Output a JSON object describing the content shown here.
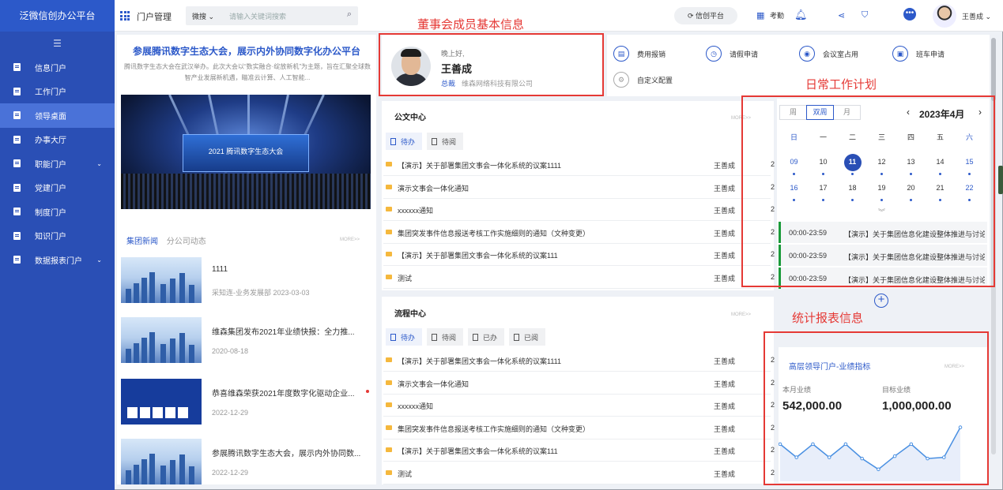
{
  "app": {
    "brand": "泛微信创办公平台"
  },
  "sidebar": {
    "items": [
      {
        "label": "信息门户",
        "caret": ""
      },
      {
        "label": "工作门户",
        "caret": ""
      },
      {
        "label": "领导桌面",
        "caret": ""
      },
      {
        "label": "办事大厅",
        "caret": ""
      },
      {
        "label": "职能门户",
        "caret": "⌄"
      },
      {
        "label": "党建门户",
        "caret": ""
      },
      {
        "label": "制度门户",
        "caret": ""
      },
      {
        "label": "知识门户",
        "caret": ""
      },
      {
        "label": "数据报表门户",
        "caret": "⌄"
      }
    ],
    "active_index": 2
  },
  "header": {
    "title": "门户管理",
    "search": {
      "scope": "微搜",
      "placeholder": "请输入关键词搜索"
    },
    "platform_label": "信创平台",
    "attendance_label": "考勤",
    "user_name": "王善成"
  },
  "news": {
    "headline": "参展腾讯数字生态大会，展示内外协同数字化办公平台",
    "summary": "腾讯数字生态大会在武汉举办。此次大会以“数实融合·绽放新机”为主题，旨在汇聚全球数智产业发展新机遇，瞄准云计算、人工智能...",
    "hero_caption": "2021 腾讯数字生态大会",
    "tabs": [
      "集团新闻",
      "分公司动态"
    ],
    "more": "MORE>>",
    "items": [
      {
        "title": "1111",
        "meta": "采知连-业务发展部 2023-03-03"
      },
      {
        "title": "维森集团发布2021年业绩快报：全力推...",
        "meta": "2020-08-18"
      },
      {
        "title": "恭喜维森荣获2021年度数字化驱动企业...",
        "meta": "2022-12-29"
      },
      {
        "title": "参展腾讯数字生态大会，展示内外协同数...",
        "meta": "2022-12-29"
      }
    ]
  },
  "profile": {
    "greeting": "晚上好,",
    "name": "王善成",
    "title": "总裁",
    "company": "维森网络科技有限公司"
  },
  "quick_actions": [
    {
      "label": "费用报销",
      "icon": "receipt-icon"
    },
    {
      "label": "请假申请",
      "icon": "clock-icon"
    },
    {
      "label": "会议室占用",
      "icon": "meeting-icon"
    },
    {
      "label": "班车申请",
      "icon": "bus-icon"
    },
    {
      "label": "自定义配置",
      "icon": "gear-icon"
    }
  ],
  "doc_center": {
    "title": "公文中心",
    "more": "MORE>>",
    "tabs": [
      "待办",
      "待阅"
    ],
    "rows": [
      {
        "title": "【演示】关于部署集团文事会一体化系统的议案1111",
        "user": "王善成",
        "tail": "2"
      },
      {
        "title": "演示文事会一体化通知",
        "user": "王善成",
        "tail": "2"
      },
      {
        "title": "xxxxxx通知",
        "user": "王善成",
        "tail": "2"
      },
      {
        "title": "集团突发事件信息报送考核工作实施细则的通知（文种变更）",
        "user": "王善成",
        "tail": "2"
      },
      {
        "title": "【演示】关于部署集团文事会一体化系统的议案111",
        "user": "王善成",
        "tail": "2"
      },
      {
        "title": "测试",
        "user": "王善成",
        "tail": "2"
      }
    ]
  },
  "flow_center": {
    "title": "流程中心",
    "more": "MORE>>",
    "tabs": [
      "待办",
      "待阅",
      "已办",
      "已阅"
    ],
    "rows": [
      {
        "title": "【演示】关于部署集团文事会一体化系统的议案1111",
        "user": "王善成",
        "tail": "2"
      },
      {
        "title": "演示文事会一体化通知",
        "user": "王善成",
        "tail": "2"
      },
      {
        "title": "xxxxxx通知",
        "user": "王善成",
        "tail": "2"
      },
      {
        "title": "集团突发事件信息报送考核工作实施细则的通知（文种变更）",
        "user": "王善成",
        "tail": "2"
      },
      {
        "title": "【演示】关于部署集团文事会一体化系统的议案111",
        "user": "王善成",
        "tail": "2"
      },
      {
        "title": "测试",
        "user": "王善成",
        "tail": "2"
      }
    ]
  },
  "calendar": {
    "views": [
      "周",
      "双周",
      "月"
    ],
    "active_view": "双周",
    "month": "2023年4月",
    "prev": "‹",
    "next": "›",
    "weekdays": [
      "日",
      "一",
      "二",
      "三",
      "四",
      "五",
      "六"
    ],
    "weeks": [
      [
        "09",
        "10",
        "11",
        "12",
        "13",
        "14",
        "15"
      ],
      [
        "16",
        "17",
        "18",
        "19",
        "20",
        "21",
        "22"
      ]
    ],
    "today": "11",
    "expand": "︾",
    "events": [
      {
        "time": "00:00-23:59",
        "title": "【演示】关于集团信息化建设整体推进与讨论..."
      },
      {
        "time": "00:00-23:59",
        "title": "【演示】关于集团信息化建设整体推进与讨论..."
      },
      {
        "time": "00:00-23:59",
        "title": "【演示】关于集团信息化建设整体推进与讨论..."
      }
    ],
    "add": "+"
  },
  "stats": {
    "title": "高层领导门户-业绩指标",
    "more": "MORE>>",
    "current_label": "本月业绩",
    "current_value": "542,000.00",
    "target_label": "目标业绩",
    "target_value": "1,000,000.00"
  },
  "chart_data": {
    "type": "line",
    "values": [
      41,
      30,
      41,
      30,
      41,
      29,
      20,
      31,
      41,
      29,
      30,
      55
    ],
    "ylim": [
      10,
      60
    ],
    "grid": false,
    "color": "#4a90e2"
  },
  "annotations": {
    "profile": "董事会成员基本信息",
    "calendar": "日常工作计划",
    "stats": "统计报表信息"
  },
  "colors": {
    "brand": "#2a4fb5",
    "accent": "#2c59c9",
    "annotation": "#e53935",
    "event_bar": "#1a9a3a"
  }
}
